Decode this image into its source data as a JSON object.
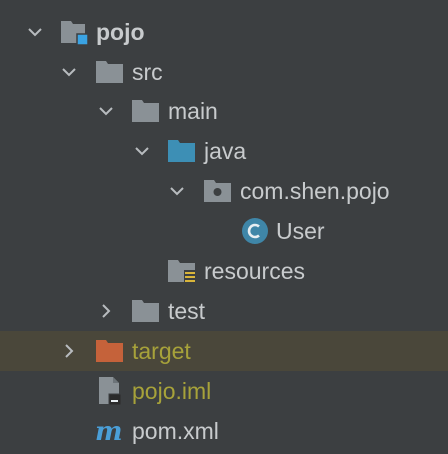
{
  "project_tree": {
    "items": [
      {
        "label": "pojo",
        "icon": "module-folder-icon",
        "expanded": true
      },
      {
        "label": "src",
        "icon": "folder-icon",
        "expanded": true
      },
      {
        "label": "main",
        "icon": "folder-icon",
        "expanded": true
      },
      {
        "label": "java",
        "icon": "source-root-folder-icon",
        "expanded": true
      },
      {
        "label": "com.shen.pojo",
        "icon": "package-icon",
        "expanded": true
      },
      {
        "label": "User",
        "icon": "java-class-icon"
      },
      {
        "label": "resources",
        "icon": "resources-folder-icon"
      },
      {
        "label": "test",
        "icon": "folder-icon",
        "expanded": false
      },
      {
        "label": "target",
        "icon": "excluded-folder-icon",
        "expanded": false,
        "selected": true
      },
      {
        "label": "pojo.iml",
        "icon": "iml-file-icon"
      },
      {
        "label": "pom.xml",
        "icon": "maven-icon"
      }
    ]
  },
  "colors": {
    "background": "#3c3f41",
    "selection": "#4a473a",
    "text": "#c8cbcd",
    "excluded_text": "#a7a23a",
    "folder": "#8a9196",
    "source_folder": "#3d8fb5",
    "excluded_folder": "#c5623a",
    "module_badge": "#3aa3e3",
    "class_badge": "#3f86a8",
    "maven": "#4a9fd8"
  }
}
